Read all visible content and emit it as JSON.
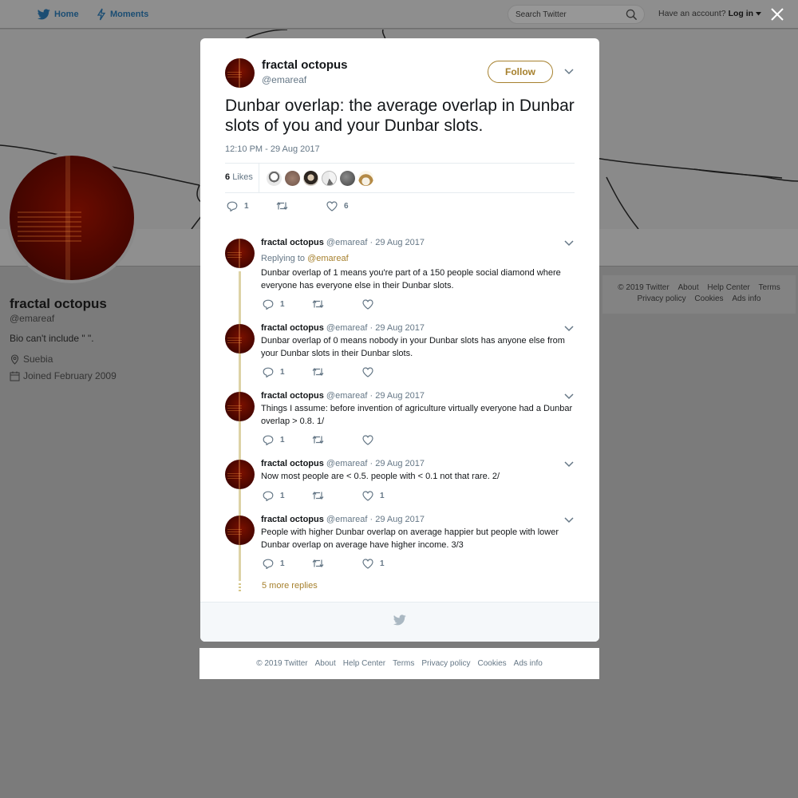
{
  "nav": {
    "home_label": "Home",
    "moments_label": "Moments",
    "search_placeholder": "Search Twitter",
    "account_prompt": "Have an account?",
    "login_label": "Log in"
  },
  "profile": {
    "name": "fractal octopus",
    "handle": "@emareaf",
    "bio": "Bio can't include \" \".",
    "location": "Suebia",
    "joined": "Joined February 2009"
  },
  "side_footer": {
    "copyright": "© 2019 Twitter",
    "about": "About",
    "help": "Help Center",
    "terms": "Terms",
    "privacy": "Privacy policy",
    "cookies": "Cookies",
    "ads": "Ads info"
  },
  "tweet": {
    "name": "fractal octopus",
    "handle": "@emareaf",
    "follow_label": "Follow",
    "text": "Dunbar overlap: the average overlap in Dunbar slots of you and your Dunbar slots.",
    "timestamp": "12:10 PM - 29 Aug 2017",
    "likes_count": "6",
    "likes_label": "Likes",
    "reply_count": "1",
    "retweet_count": "",
    "like_count": "6"
  },
  "replies": [
    {
      "name": "fractal octopus",
      "handle": "@emareaf",
      "date": "· 29 Aug 2017",
      "replying_prefix": "Replying to",
      "replying_to": "@emareaf",
      "text": "Dunbar overlap of 1 means you're part of a 150 people social diamond where everyone has everyone else in their Dunbar slots.",
      "reply_count": "1",
      "like_count": ""
    },
    {
      "name": "fractal octopus",
      "handle": "@emareaf",
      "date": "· 29 Aug 2017",
      "text": "Dunbar overlap of 0 means nobody in your Dunbar slots has anyone else from your Dunbar slots in their Dunbar slots.",
      "reply_count": "1",
      "like_count": ""
    },
    {
      "name": "fractal octopus",
      "handle": "@emareaf",
      "date": "· 29 Aug 2017",
      "text": "Things I assume: before invention of agriculture virtually everyone had a Dunbar overlap > 0.8. 1/",
      "reply_count": "1",
      "like_count": ""
    },
    {
      "name": "fractal octopus",
      "handle": "@emareaf",
      "date": "· 29 Aug 2017",
      "text": "Now most people are < 0.5. people with < 0.1 not that rare. 2/",
      "reply_count": "1",
      "like_count": "1"
    },
    {
      "name": "fractal octopus",
      "handle": "@emareaf",
      "date": "· 29 Aug 2017",
      "text": "People with higher Dunbar overlap on average happier but people with lower Dunbar overlap on average have higher income. 3/3",
      "reply_count": "1",
      "like_count": "1"
    }
  ],
  "more_replies_label": "5 more replies",
  "footer": {
    "copyright": "© 2019 Twitter",
    "about": "About",
    "help": "Help Center",
    "terms": "Terms",
    "privacy": "Privacy policy",
    "cookies": "Cookies",
    "ads": "Ads info"
  },
  "colors": {
    "accent_gold": "#a6802d",
    "secondary_text": "#657786",
    "thread_line": "#ddd3a6"
  }
}
